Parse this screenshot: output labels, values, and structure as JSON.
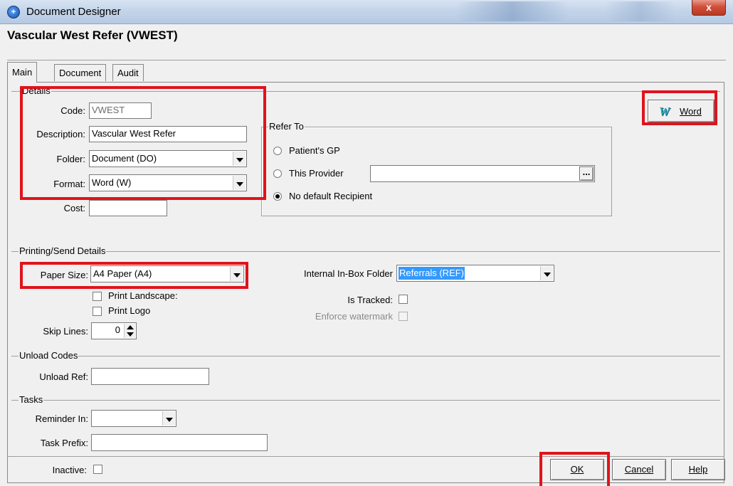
{
  "window": {
    "title": "Document Designer",
    "close_label": "x"
  },
  "heading": "Vascular West Refer (VWEST)",
  "tabs": [
    {
      "label": "Main",
      "active": true
    },
    {
      "label": "Document",
      "active": false
    },
    {
      "label": "Audit",
      "active": false
    }
  ],
  "details": {
    "group_title": "Details",
    "code": {
      "label": "Code:",
      "value": "VWEST"
    },
    "description": {
      "label": "Description:",
      "value": "Vascular West Refer"
    },
    "folder": {
      "label": "Folder:",
      "value": "Document (DO)"
    },
    "format": {
      "label": "Format:",
      "value": "Word (W)"
    },
    "cost": {
      "label": "Cost:",
      "value": ""
    },
    "word_button": {
      "icon_letter": "W",
      "label": "Word"
    }
  },
  "refer_to": {
    "group_title": "Refer To",
    "options": [
      {
        "label": "Patient's GP",
        "selected": false
      },
      {
        "label": "This Provider",
        "selected": false
      },
      {
        "label": "No default Recipient",
        "selected": true
      }
    ],
    "provider_value": "",
    "browse_label": "..."
  },
  "printing": {
    "group_title": "Printing/Send Details",
    "paper_size": {
      "label": "Paper Size:",
      "value": "A4 Paper (A4)"
    },
    "print_landscape": {
      "label": "Print Landscape:",
      "checked": false
    },
    "print_logo": {
      "label": "Print Logo",
      "checked": false
    },
    "skip_lines": {
      "label": "Skip Lines:",
      "value": "0"
    },
    "inbox_folder": {
      "label": "Internal In-Box Folder",
      "value": "Referrals (REF)"
    },
    "is_tracked": {
      "label": "Is Tracked:",
      "checked": false
    },
    "enforce_watermark": {
      "label": "Enforce watermark",
      "checked": false
    }
  },
  "unload": {
    "group_title": "Unload Codes",
    "unload_ref": {
      "label": "Unload Ref:",
      "value": ""
    }
  },
  "tasks": {
    "group_title": "Tasks",
    "reminder_in": {
      "label": "Reminder In:",
      "value": ""
    },
    "task_prefix": {
      "label": "Task Prefix:",
      "value": ""
    }
  },
  "footer": {
    "inactive": {
      "label": "Inactive:",
      "checked": false
    },
    "ok_label": "OK",
    "cancel_label": "Cancel",
    "help_label": "Help"
  },
  "colors": {
    "highlight_border": "#e0131b",
    "selection": "#3399ff",
    "dialog_bg": "#f0f0f0"
  }
}
